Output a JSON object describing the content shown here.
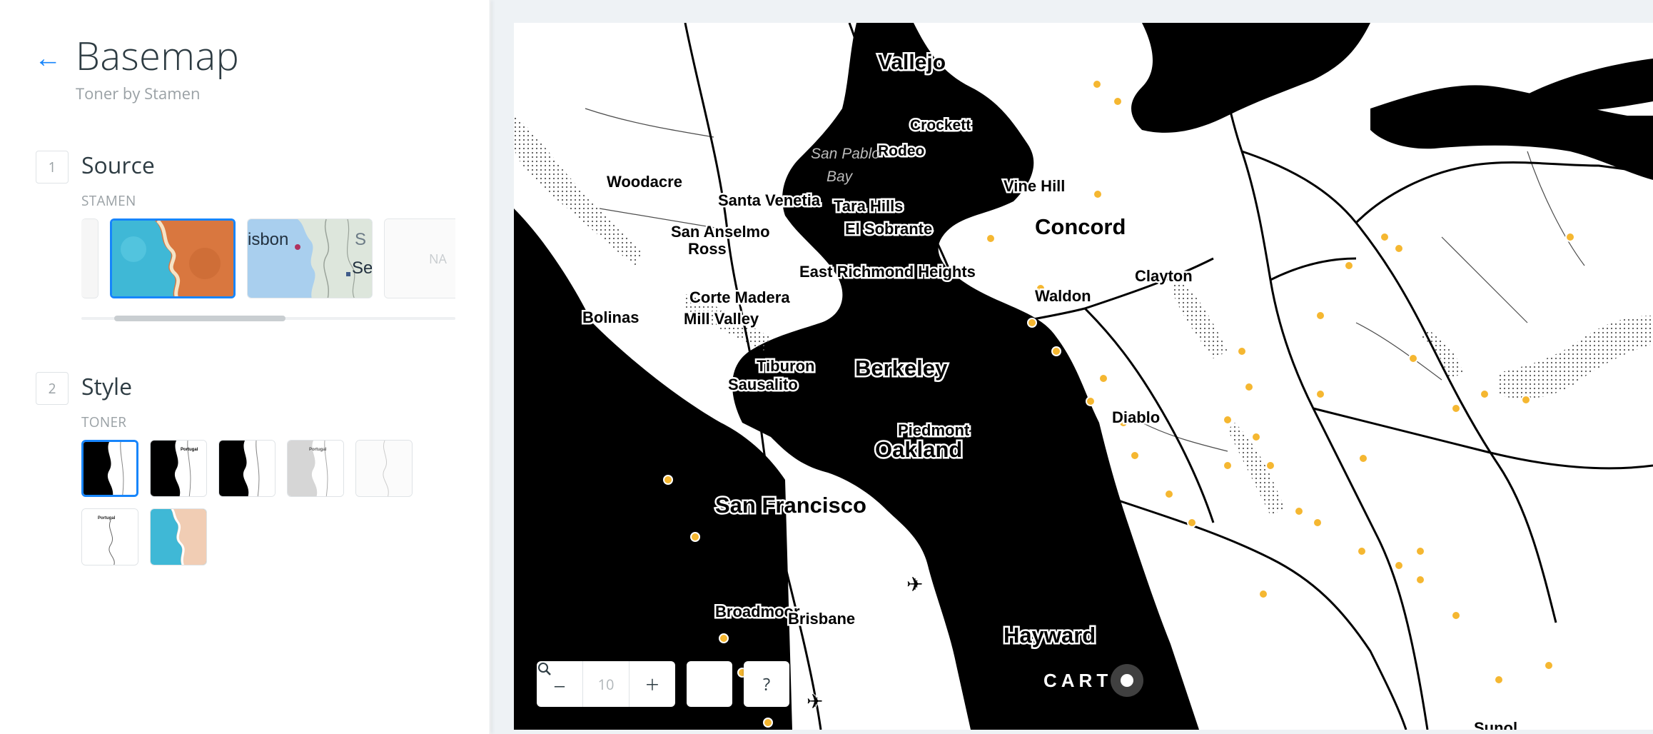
{
  "header": {
    "back_icon": "arrow-left-icon",
    "title": "Basemap",
    "subtitle": "Toner by Stamen"
  },
  "source": {
    "step": "1",
    "label": "Source",
    "provider": "STAMEN",
    "thumbnails": [
      {
        "name": "partial",
        "selected": false
      },
      {
        "name": "watercolor",
        "selected": true
      },
      {
        "name": "terrain",
        "selected": false,
        "text_a": "isbon",
        "text_b": "S",
        "text_c": "Se"
      },
      {
        "name": "blank",
        "selected": false,
        "text": "NA"
      }
    ]
  },
  "style": {
    "step": "2",
    "label": "Style",
    "provider": "TONER",
    "thumb_caption": "Portugal",
    "options": [
      "toner",
      "toner-background",
      "toner-lines",
      "toner-hybrid",
      "toner-labels",
      "toner-lite",
      "watercolor"
    ],
    "selected": "toner"
  },
  "map": {
    "labels": {
      "vallejo": "Vallejo",
      "crockett": "Crockett",
      "rodeo": "Rodeo",
      "san_pablo": "San Pablo",
      "bay": "Bay",
      "tara_hills": "Tara Hills",
      "el_sobrante": "El Sobrante",
      "vine_hill": "Vine Hill",
      "concord": "Concord",
      "clayton": "Clayton",
      "waldon": "Waldon",
      "woodacre": "Woodacre",
      "santa_venetia": "Santa Venetia",
      "san_anselmo": "San Anselmo",
      "ross": "Ross",
      "east_richmond_heights": "East Richmond Heights",
      "corte_madera": "Corte Madera",
      "mill_valley": "Mill Valley",
      "bolinas": "Bolinas",
      "berkeley": "Berkeley",
      "tiburon": "Tiburon",
      "sausalito": "Sausalito",
      "piedmont": "Piedmont",
      "oakland": "Oakland",
      "diablo": "Diablo",
      "san_francisco": "San Francisco",
      "broadmoor": "Broadmoor",
      "brisbane": "Brisbane",
      "hayward": "Hayward",
      "sunol": "Sunol"
    },
    "zoom": {
      "minus_icon": "minus-icon",
      "level": "10",
      "plus_icon": "plus-icon"
    },
    "search_icon": "search-icon",
    "help": "?",
    "brand": "CART",
    "point_color": "#f5b731"
  },
  "colors": {
    "accent": "#1785fb",
    "text": "#2e3c43",
    "muted": "#9aa1a5",
    "water": "#000000",
    "land": "#ffffff"
  }
}
